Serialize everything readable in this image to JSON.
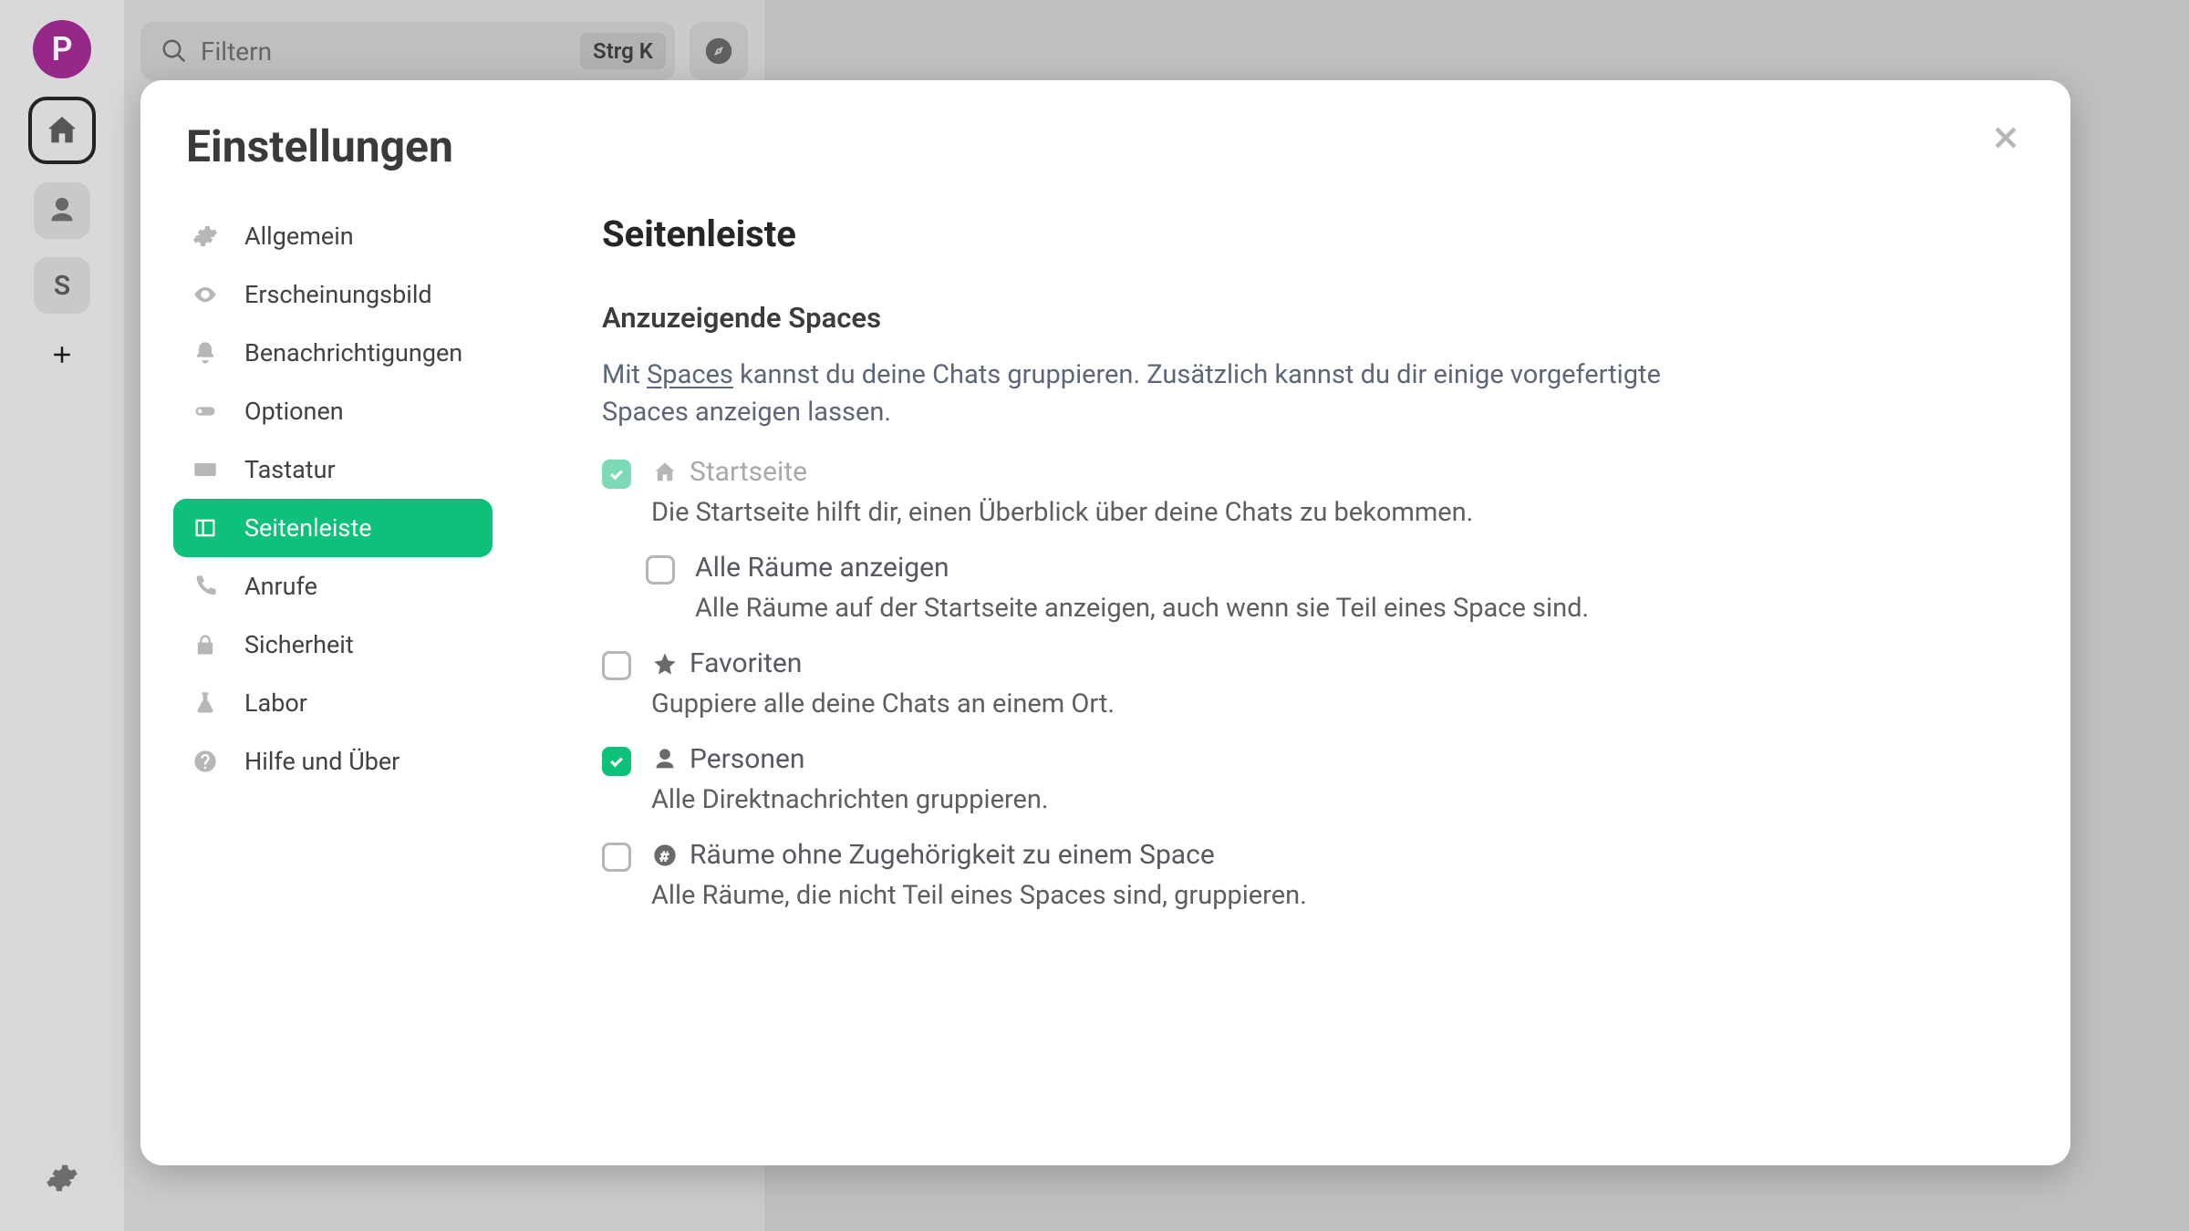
{
  "rail": {
    "avatar_letter": "P",
    "space_letter": "S"
  },
  "search": {
    "placeholder": "Filtern",
    "shortcut": "Strg K"
  },
  "dialog": {
    "title": "Einstellungen",
    "nav": [
      {
        "id": "general",
        "label": "Allgemein"
      },
      {
        "id": "appearance",
        "label": "Erscheinungsbild"
      },
      {
        "id": "notifications",
        "label": "Benachrichtigungen"
      },
      {
        "id": "options",
        "label": "Optionen"
      },
      {
        "id": "keyboard",
        "label": "Tastatur"
      },
      {
        "id": "sidebar",
        "label": "Seitenleiste"
      },
      {
        "id": "calls",
        "label": "Anrufe"
      },
      {
        "id": "security",
        "label": "Sicherheit"
      },
      {
        "id": "labs",
        "label": "Labor"
      },
      {
        "id": "about",
        "label": "Hilfe und Über"
      }
    ],
    "panel": {
      "title": "Seitenleiste",
      "section_title": "Anzuzeigende Spaces",
      "section_desc_pre": "Mit ",
      "section_desc_link": "Spaces",
      "section_desc_post": " kannst du deine Chats gruppieren. Zusätzlich kannst du dir einige vorgefertigte Spaces anzeigen lassen.",
      "options": {
        "home": {
          "label": "Startseite",
          "help": "Die Startseite hilft dir, einen Überblick über deine Chats zu bekommen.",
          "checked": true,
          "locked": true
        },
        "allrooms": {
          "label": "Alle Räume anzeigen",
          "help": "Alle Räume auf der Startseite anzeigen, auch wenn sie Teil eines Space sind.",
          "checked": false
        },
        "favorites": {
          "label": "Favoriten",
          "help": "Guppiere alle deine Chats an einem Ort.",
          "checked": false
        },
        "people": {
          "label": "Personen",
          "help": "Alle Direktnachrichten gruppieren.",
          "checked": true
        },
        "orphan": {
          "label": "Räume ohne Zugehörigkeit zu einem Space",
          "help": "Alle Räume, die nicht Teil eines Spaces sind, gruppieren.",
          "checked": false
        }
      }
    }
  }
}
